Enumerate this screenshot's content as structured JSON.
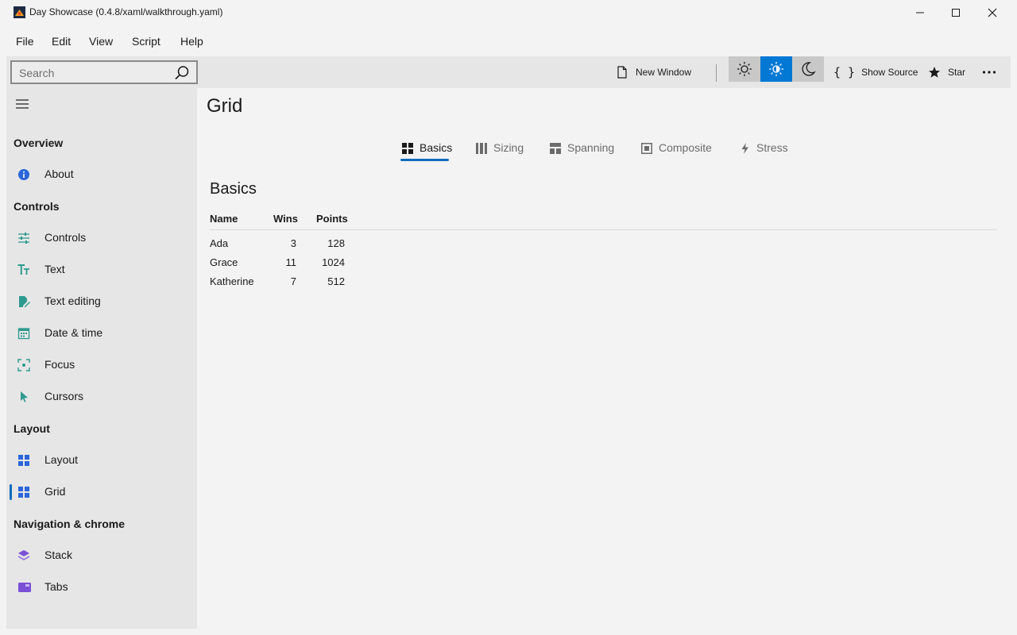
{
  "window": {
    "title": "Day Showcase (0.4.8/xaml/walkthrough.yaml)"
  },
  "menu": [
    "File",
    "Edit",
    "View",
    "Script",
    "Help"
  ],
  "toolbar": {
    "search_placeholder": "Search",
    "new_window": "New Window",
    "show_source": "Show Source",
    "star": "Star"
  },
  "sidebar": {
    "sections": [
      {
        "title": "Overview",
        "items": [
          {
            "label": "About",
            "icon": "info-icon"
          }
        ]
      },
      {
        "title": "Controls",
        "items": [
          {
            "label": "Controls",
            "icon": "sliders-icon"
          },
          {
            "label": "Text",
            "icon": "text-size-icon"
          },
          {
            "label": "Text editing",
            "icon": "edit-doc-icon"
          },
          {
            "label": "Date & time",
            "icon": "calendar-icon"
          },
          {
            "label": "Focus",
            "icon": "focus-icon"
          },
          {
            "label": "Cursors",
            "icon": "cursor-icon"
          }
        ]
      },
      {
        "title": "Layout",
        "items": [
          {
            "label": "Layout",
            "icon": "grid-icon"
          },
          {
            "label": "Grid",
            "icon": "grid-icon",
            "selected": true
          }
        ]
      },
      {
        "title": "Navigation & chrome",
        "items": [
          {
            "label": "Stack",
            "icon": "stack-icon"
          },
          {
            "label": "Tabs",
            "icon": "tabs-icon"
          }
        ]
      }
    ]
  },
  "page": {
    "title": "Grid",
    "tabs": [
      {
        "label": "Basics",
        "icon": "grid-icon",
        "active": true
      },
      {
        "label": "Sizing",
        "icon": "columns-icon"
      },
      {
        "label": "Spanning",
        "icon": "spanning-icon"
      },
      {
        "label": "Composite",
        "icon": "composite-icon"
      },
      {
        "label": "Stress",
        "icon": "lightning-icon"
      }
    ],
    "section_title": "Basics",
    "table": {
      "columns": [
        "Name",
        "Wins",
        "Points"
      ],
      "rows": [
        [
          "Ada",
          "3",
          "128"
        ],
        [
          "Grace",
          "11",
          "1024"
        ],
        [
          "Katherine",
          "7",
          "512"
        ]
      ]
    }
  },
  "colors": {
    "accent": "#0f6cbd",
    "theme_active": "#0078d4",
    "sidebar_bg": "#e6e6e6",
    "page_bg": "#f3f3f3"
  }
}
